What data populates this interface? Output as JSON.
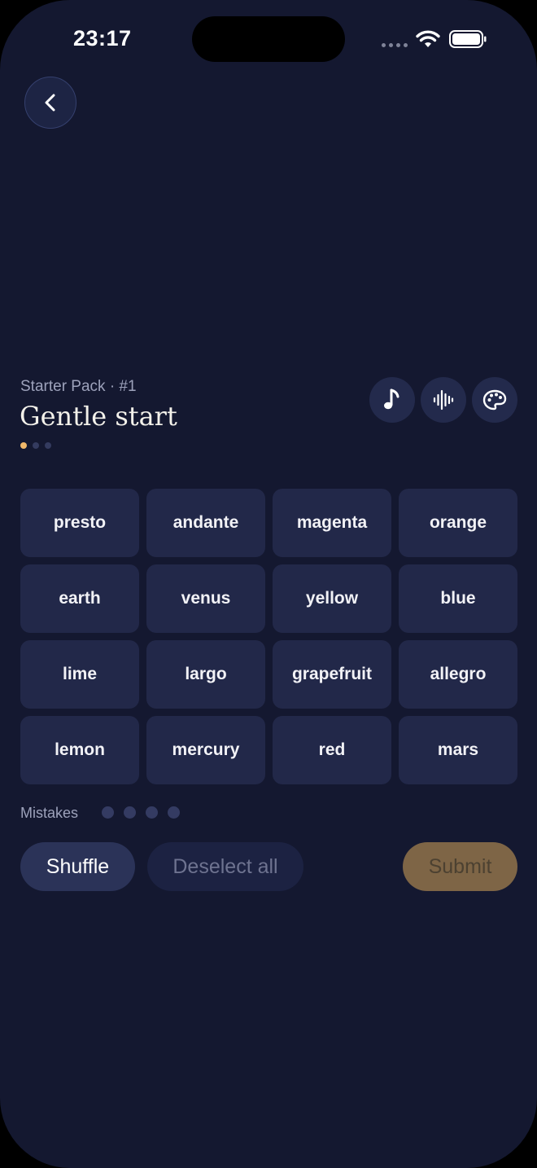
{
  "status_bar": {
    "time": "23:17"
  },
  "icons": {
    "back": "chevron-left-icon",
    "music": "music-note-icon",
    "sound": "audio-waveform-icon",
    "theme": "palette-icon",
    "wifi": "wifi-icon",
    "battery": "battery-icon",
    "signal": "cellular-signal-icon"
  },
  "header": {
    "pack_label": "Starter Pack · #1",
    "title": "Gentle start",
    "progress": {
      "total": 3,
      "current": 1
    }
  },
  "grid": {
    "tiles": [
      "presto",
      "andante",
      "magenta",
      "orange",
      "earth",
      "venus",
      "yellow",
      "blue",
      "lime",
      "largo",
      "grapefruit",
      "allegro",
      "lemon",
      "mercury",
      "red",
      "mars"
    ]
  },
  "mistakes": {
    "label": "Mistakes",
    "remaining": 4
  },
  "actions": {
    "shuffle": "Shuffle",
    "deselect": "Deselect all",
    "submit": "Submit"
  },
  "colors": {
    "background": "#141830",
    "tile": "#222849",
    "accent": "#f0b86a",
    "submit_disabled": "#7e6546"
  }
}
